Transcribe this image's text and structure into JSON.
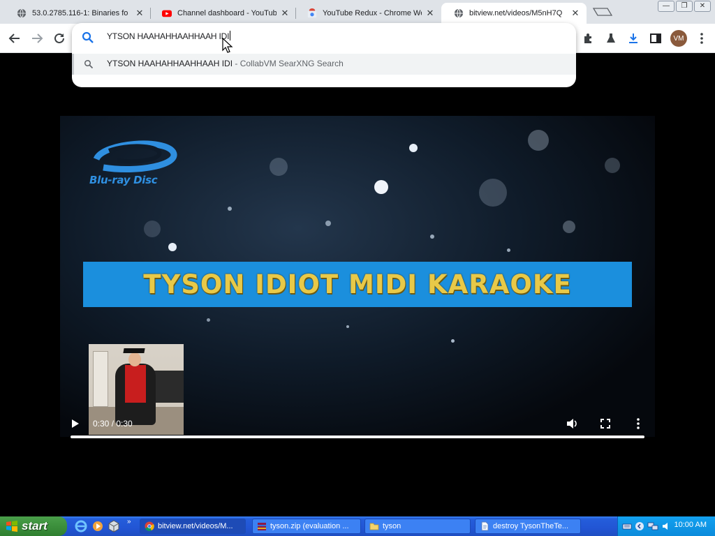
{
  "browser": {
    "tabs": [
      {
        "title": "53.0.2785.116-1: Binaries fo",
        "icon": "globe-icon",
        "active": false
      },
      {
        "title": "Channel dashboard - YouTube",
        "icon": "youtube-icon",
        "active": false
      },
      {
        "title": "YouTube Redux - Chrome We",
        "icon": "chrome-webstore-icon",
        "active": false
      },
      {
        "title": "bitview.net/videos/M5nH7Q",
        "icon": "globe-icon",
        "active": true
      }
    ],
    "profile_initials": "VM",
    "omnibox": {
      "value": "YTSON HAAHAHHAAHHAAH IDI",
      "suggestion_query": "YTSON HAAHAHHAAHHAAH IDI",
      "suggestion_source": " - CollabVM SearXNG Search"
    }
  },
  "video": {
    "logo_text": "Blu-ray Disc",
    "banner_title": "TYSON IDIOT MIDI KARAOKE",
    "time_display": "0:30 / 0:30",
    "progress": 1.0
  },
  "taskbar": {
    "start_label": "start",
    "tasks": [
      {
        "label": "bitview.net/videos/M...",
        "icon": "chrome-icon",
        "active": true
      },
      {
        "label": "tyson.zip (evaluation ...",
        "icon": "winrar-icon",
        "active": false
      },
      {
        "label": "tyson",
        "icon": "folder-icon",
        "active": false
      },
      {
        "label": "destroy TysonTheTe...",
        "icon": "document-icon",
        "active": false
      }
    ],
    "clock": "10:00 AM"
  },
  "colors": {
    "banner_bg": "#1b8fdd",
    "banner_text": "#e8c948",
    "taskbar_blue": "#245edb",
    "start_green": "#3c8f3c"
  }
}
